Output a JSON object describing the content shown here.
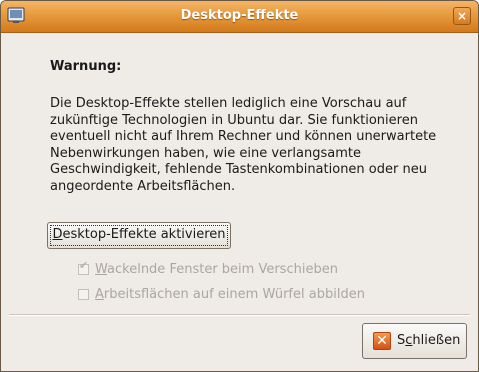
{
  "window": {
    "title": "Desktop-Effekte",
    "close_glyph": "×",
    "icon": "window-menu-icon"
  },
  "dialog": {
    "heading": "Warnung:",
    "body_lines": [
      "Die Desktop-Effekte stellen lediglich eine Vorschau auf",
      "zukünftige Technologien in Ubuntu dar. Sie funktionieren",
      "eventuell nicht auf Ihrem Rechner und können unerwartete",
      "Nebenwirkungen haben, wie eine verlangsamte",
      "Geschwindigkeit, fehlende Tastenkombinationen oder neu",
      "angeordente Arbeitsflächen."
    ],
    "activate_button": {
      "mnemonic": "D",
      "rest": "esktop-Effekte aktivieren"
    },
    "options": [
      {
        "mnemonic": "W",
        "rest": "ackelnde Fenster beim Verschieben",
        "checked": true,
        "enabled": false
      },
      {
        "mnemonic": "A",
        "rest": "rbeitsflächen auf einem Würfel abbilden",
        "checked": false,
        "enabled": false
      }
    ],
    "close_button": {
      "pre": "S",
      "mnemonic": "c",
      "rest": "hließen",
      "icon": "close-icon"
    }
  },
  "colors": {
    "titlebar": "#e79a3d",
    "window_bg": "#efebe7",
    "disabled_text": "#aba6a0"
  }
}
